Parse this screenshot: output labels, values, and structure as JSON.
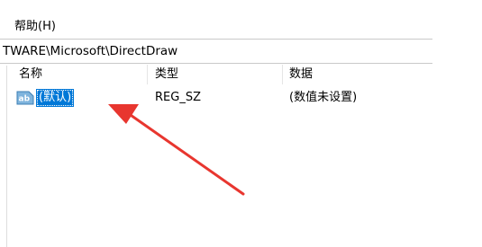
{
  "menu": {
    "help_label": "帮助(H)"
  },
  "address": {
    "path": "TWARE\\Microsoft\\DirectDraw"
  },
  "columns": {
    "name": "名称",
    "type": "类型",
    "data": "数据"
  },
  "rows": [
    {
      "icon": "ab-string-value-icon",
      "name": "(默认)",
      "type": "REG_SZ",
      "data": "(数值未设置)"
    }
  ],
  "colors": {
    "selection": "#0078d7",
    "arrow": "#e8362f"
  }
}
